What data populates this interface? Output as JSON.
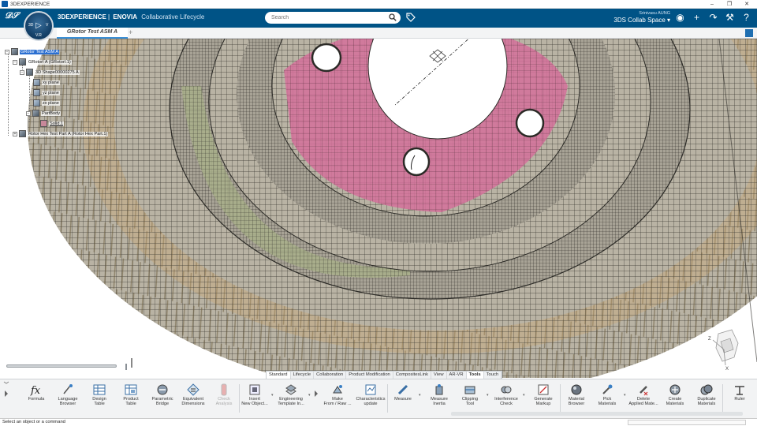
{
  "window": {
    "title": "3DEXPERIENCE",
    "controls": [
      "–",
      "❐",
      "✕"
    ]
  },
  "header": {
    "brand_3d": "3DEXPERIENCE",
    "brand_sep": "|",
    "brand_app": "ENOVIA",
    "brand_role": "Collaborative Lifecycle",
    "search_placeholder": "Search",
    "user_name": "Srinivasu AUNG",
    "collab_space": "3DS Collab Space ▾",
    "accent": "#005386"
  },
  "compass": {
    "version": "V.R",
    "left_label": "3D",
    "right_label": "V"
  },
  "tabs": {
    "active": "GRotor Test ASM A",
    "add": "+"
  },
  "tree": {
    "root": "GRotor Test ASM A",
    "product_a": "GRotorI A (GRotorI.1)",
    "shape": "3D Shape00000275 A",
    "xy": "xy plane",
    "yz": "yz plane",
    "zx": "zx plane",
    "partbody": "PartBody",
    "solid": "Solid.1",
    "product_b": "Rotor Hex Test Part A (Rotor Hex Part.1)"
  },
  "axes": {
    "z": "Z",
    "x": "X"
  },
  "action_tabs": [
    "Standard",
    "Lifecycle",
    "Collaboration",
    "Product Modification",
    "CompositesLink",
    "View",
    "AR-VR",
    "Tools",
    "Touch"
  ],
  "active_action_tab": "Tools",
  "actions": {
    "formula": "Formula",
    "language_browser": [
      "Language",
      "Browser"
    ],
    "design_table": [
      "Design",
      "Table"
    ],
    "product_table": [
      "Product",
      "Table"
    ],
    "parametric_bridge": [
      "Parametric",
      "Bridge"
    ],
    "equivalent_dimensions": [
      "Equivalent",
      "Dimensions"
    ],
    "check_analysis": [
      "Check",
      "Analysis"
    ],
    "insert_new_object": [
      "Insert",
      "New Object..."
    ],
    "engineering_template": [
      "Engineering",
      "Template In..."
    ],
    "make_from_raw": [
      "Make",
      "From / Raw ..."
    ],
    "characteristics_update": [
      "Characteristics",
      "update"
    ],
    "measure": "Measure",
    "measure_inertia": [
      "Measure",
      "Inertia"
    ],
    "clipping_tool": [
      "Clipping",
      "Tool"
    ],
    "interference_check": [
      "Interference",
      "Check"
    ],
    "generate_markup": [
      "Generate",
      "Markup"
    ],
    "material_browser": [
      "Material",
      "Browser"
    ],
    "pick_materials": [
      "Pick",
      "Materials"
    ],
    "delete_applied_materials": [
      "Delete",
      "Applied Mate..."
    ],
    "create_materials": [
      "Create",
      "Materials"
    ],
    "duplicate_materials": [
      "Duplicate",
      "Materials"
    ],
    "ruler": "Ruler"
  },
  "status": {
    "message": "Select an object or a command"
  },
  "colors": {
    "mesh_base": "#b9b3a4",
    "mesh_pink": "#d4709a",
    "mesh_tan": "#c9a46e",
    "mesh_green": "#a9b08a"
  }
}
